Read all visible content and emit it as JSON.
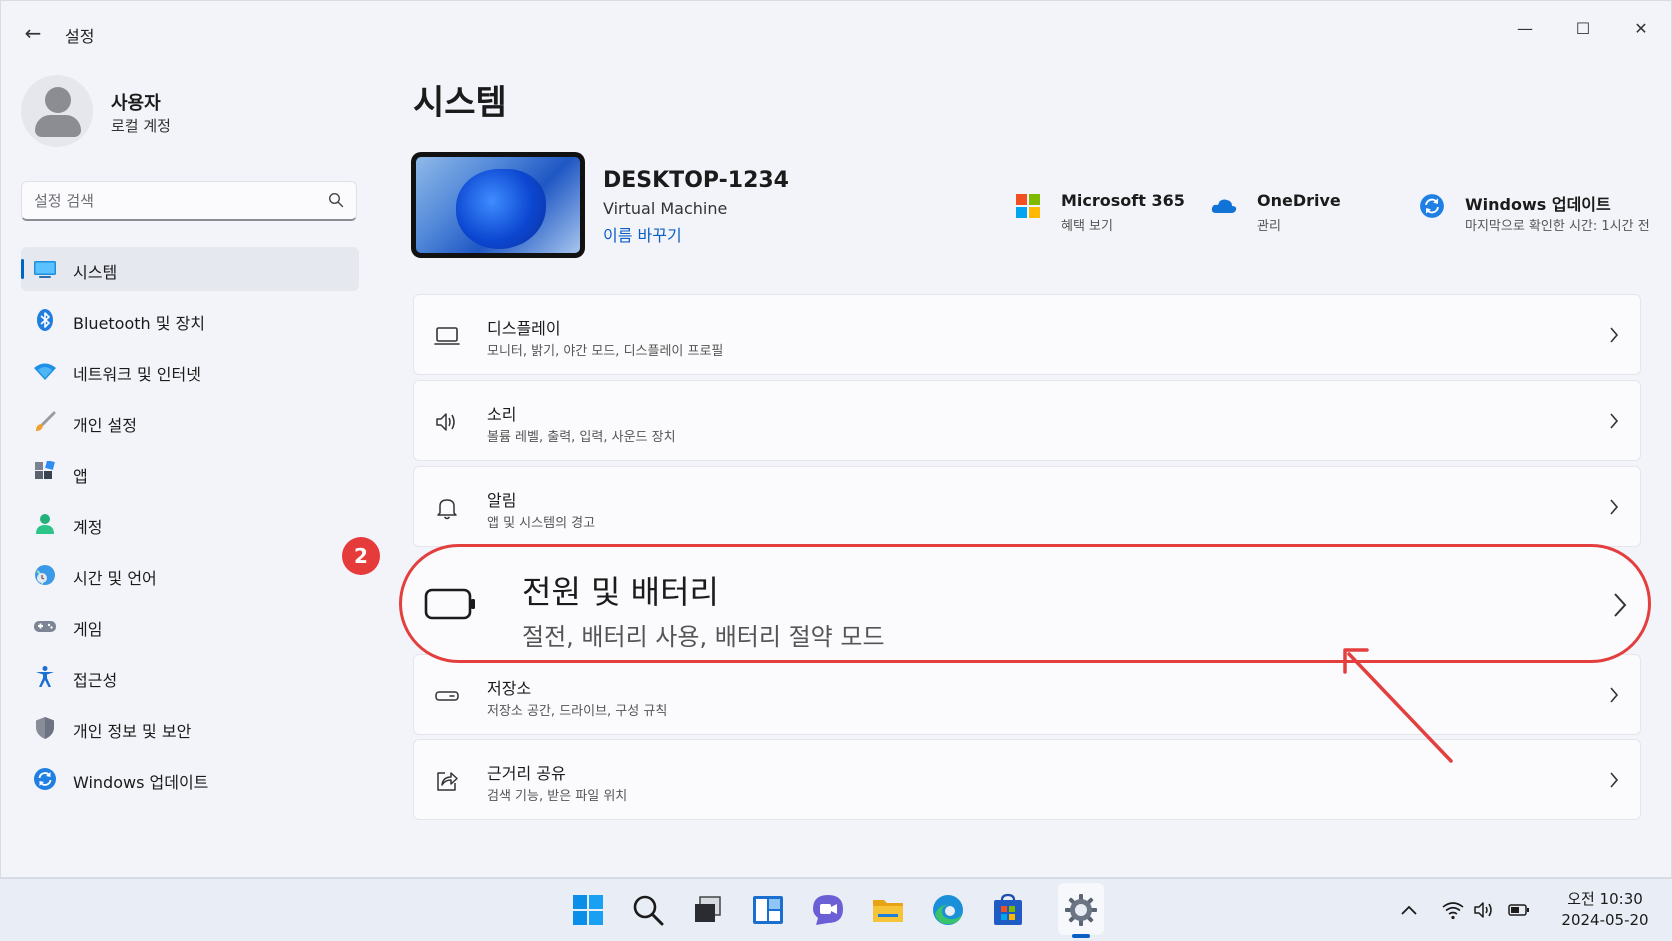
{
  "window": {
    "title": "설정",
    "back_glyph": "←",
    "minimize_glyph": "—",
    "maximize_glyph": "☐",
    "close_glyph": "✕"
  },
  "profile": {
    "name": "사용자",
    "account_type": "로컬 계정"
  },
  "search": {
    "placeholder": "설정 검색"
  },
  "sidebar": {
    "items": [
      {
        "label": "시스템",
        "icon": "monitor-icon",
        "selected": true
      },
      {
        "label": "Bluetooth 및 장치",
        "icon": "bluetooth-icon"
      },
      {
        "label": "네트워크 및 인터넷",
        "icon": "wifi-icon"
      },
      {
        "label": "개인 설정",
        "icon": "brush-icon"
      },
      {
        "label": "앱",
        "icon": "apps-icon"
      },
      {
        "label": "계정",
        "icon": "person-icon"
      },
      {
        "label": "시간 및 언어",
        "icon": "globe-clock-icon"
      },
      {
        "label": "게임",
        "icon": "gamepad-icon"
      },
      {
        "label": "접근성",
        "icon": "accessibility-icon"
      },
      {
        "label": "개인 정보 및 보안",
        "icon": "shield-icon"
      },
      {
        "label": "Windows 업데이트",
        "icon": "update-icon"
      }
    ]
  },
  "main": {
    "title": "시스템",
    "device": {
      "name": "DESKTOP-1234",
      "model": "Virtual Machine",
      "rename_link": "이름 바꾸기"
    },
    "quick_links": [
      {
        "title": "Microsoft 365",
        "sub": "혜택 보기",
        "icon": "microsoft-logo-icon"
      },
      {
        "title": "OneDrive",
        "sub": "관리",
        "icon": "cloud-icon"
      },
      {
        "title": "Windows 업데이트",
        "sub": "마지막으로 확인한 시간: 1시간 전",
        "icon": "update-icon"
      }
    ],
    "cards": [
      {
        "title": "디스플레이",
        "sub": "모니터, 밝기, 야간 모드, 디스플레이 프로필",
        "icon": "display-icon"
      },
      {
        "title": "소리",
        "sub": "볼륨 레벨, 출력, 입력, 사운드 장치",
        "icon": "speaker-icon"
      },
      {
        "title": "알림",
        "sub": "앱 및 시스템의 경고",
        "icon": "bell-icon"
      },
      {
        "title": "전원 및 배터리",
        "sub": "절전, 배터리 사용, 배터리 절약 모드",
        "icon": "battery-icon",
        "highlighted": true
      },
      {
        "title": "저장소",
        "sub": "저장소 공간, 드라이브, 구성 규칙",
        "icon": "storage-icon"
      },
      {
        "title": "근거리 공유",
        "sub": "검색 기능, 받은 파일 위치",
        "icon": "share-icon"
      }
    ]
  },
  "annotation": {
    "step_number": "2",
    "color": "#e43f3f"
  },
  "taskbar": {
    "apps": [
      "start-icon",
      "search-icon",
      "task-view-icon",
      "widgets-icon",
      "chat-icon",
      "file-explorer-icon",
      "edge-icon",
      "store-icon",
      "settings-icon"
    ],
    "active_app": "settings-icon",
    "tray": [
      "chevron-up-icon",
      "wifi-icon",
      "speaker-icon",
      "battery-icon"
    ],
    "clock_time": "오전 10:30",
    "clock_date": "2024-05-20"
  },
  "colors": {
    "accent": "#0067c0",
    "link": "#0a5fc4",
    "highlight": "#e43f3f",
    "window_bg": "#f3f4f9",
    "card_bg": "#fbfbfd"
  }
}
